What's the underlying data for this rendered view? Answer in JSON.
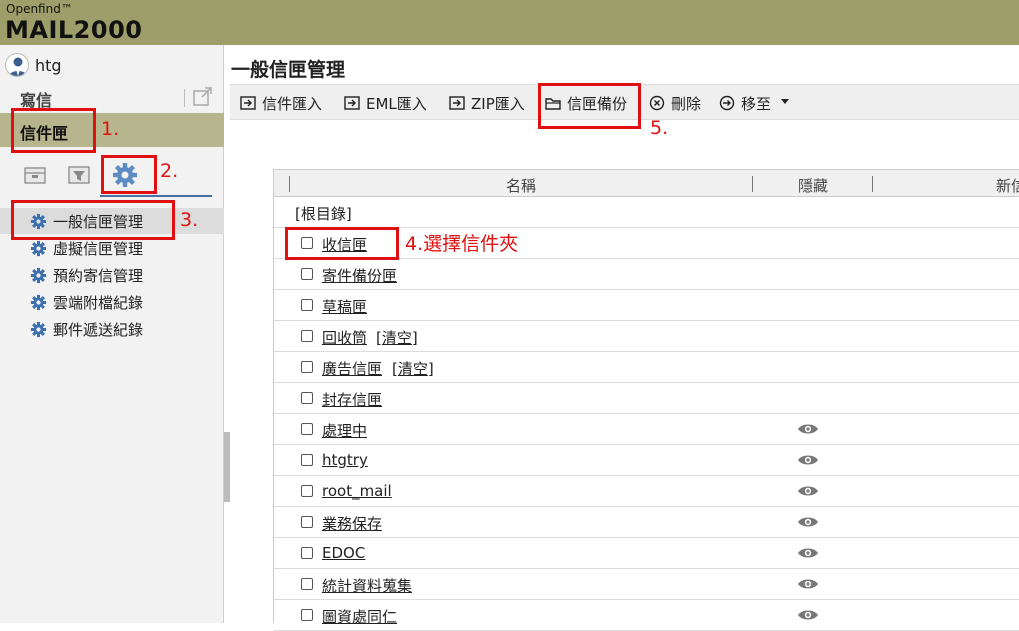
{
  "brand": {
    "small": "Openfind™",
    "big": "MAIL2000"
  },
  "user": {
    "name": "htg"
  },
  "sidebar": {
    "compose_label": "寫信",
    "inbox_label": "信件匣",
    "tabs": [
      {
        "icon": "mailbox-icon"
      },
      {
        "icon": "filter-icon"
      },
      {
        "icon": "gear-icon"
      }
    ],
    "menu": [
      {
        "label": "一般信匣管理"
      },
      {
        "label": "虛擬信匣管理"
      },
      {
        "label": "預約寄信管理"
      },
      {
        "label": "雲端附檔紀錄"
      },
      {
        "label": "郵件遞送紀錄"
      }
    ]
  },
  "main": {
    "title": "一般信匣管理",
    "toolbar": {
      "import_mail": "信件匯入",
      "import_eml": "EML匯入",
      "import_zip": "ZIP匯入",
      "backup": "信匣備份",
      "delete": "刪除",
      "move": "移至"
    },
    "table": {
      "columns": [
        "名稱",
        "隱藏",
        "新信"
      ],
      "root_label": "[根目錄]",
      "rows": [
        {
          "name": "收信匣"
        },
        {
          "name": "寄件備份匣"
        },
        {
          "name": "草稿匣"
        },
        {
          "name": "回收筒",
          "extra_open": "[",
          "extra_link": "清空",
          "extra_close": "]"
        },
        {
          "name": "廣告信匣",
          "extra_open": "[",
          "extra_link": "清空",
          "extra_close": "]"
        },
        {
          "name": "封存信匣"
        },
        {
          "name": "處理中",
          "hidden": true
        },
        {
          "name": "htgtry",
          "hidden": true
        },
        {
          "name": "root_mail",
          "hidden": true
        },
        {
          "name": "業務保存",
          "hidden": true
        },
        {
          "name": "EDOC",
          "hidden": true
        },
        {
          "name": "統計資料蒐集",
          "hidden": true
        },
        {
          "name": "圖資處同仁",
          "hidden": true
        }
      ]
    }
  },
  "annotations": {
    "n1": "1.",
    "n2": "2.",
    "n3": "3.",
    "n4": "4.選擇信件夾",
    "n5": "5."
  },
  "colors": {
    "header": "#9e9e6a",
    "inbox_bar": "#b7b58d",
    "annotation": "#e01010",
    "gear": "#3d6fae"
  }
}
